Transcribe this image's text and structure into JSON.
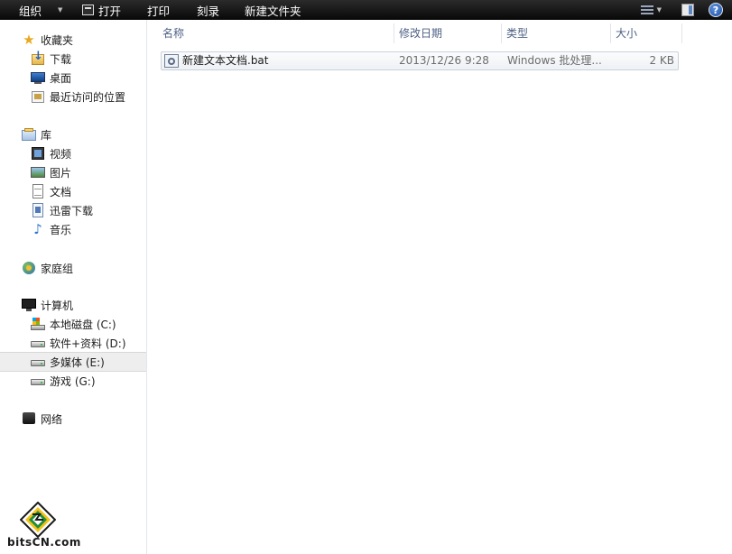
{
  "toolbar": {
    "organize": "组织",
    "open": "打开",
    "print": "打印",
    "burn": "刻录",
    "new_folder": "新建文件夹",
    "icons": [
      "open-icon",
      "views-icon",
      "preview-pane-icon",
      "help-icon"
    ]
  },
  "nav": {
    "favorites": {
      "header": "收藏夹",
      "items": [
        {
          "label": "下载",
          "icon": "download-folder-icon"
        },
        {
          "label": "桌面",
          "icon": "desktop-icon"
        },
        {
          "label": "最近访问的位置",
          "icon": "recent-places-icon"
        }
      ]
    },
    "libraries": {
      "header": "库",
      "items": [
        {
          "label": "视频",
          "icon": "video-icon"
        },
        {
          "label": "图片",
          "icon": "picture-icon"
        },
        {
          "label": "文档",
          "icon": "document-icon"
        },
        {
          "label": "迅雷下载",
          "icon": "thunder-download-icon"
        },
        {
          "label": "音乐",
          "icon": "music-icon"
        }
      ]
    },
    "homegroup": {
      "header": "家庭组"
    },
    "computer": {
      "header": "计算机",
      "items": [
        {
          "label": "本地磁盘 (C:)",
          "icon": "windows-disk-icon"
        },
        {
          "label": "软件+资料 (D:)",
          "icon": "disk-icon"
        },
        {
          "label": "多媒体 (E:)",
          "icon": "disk-icon",
          "selected": true
        },
        {
          "label": "游戏 (G:)",
          "icon": "disk-icon"
        }
      ]
    },
    "network": {
      "header": "网络"
    }
  },
  "columns": {
    "name": "名称",
    "date": "修改日期",
    "type": "类型",
    "size": "大小"
  },
  "files": [
    {
      "name": "新建文本文档.bat",
      "date": "2013/12/26 9:28",
      "type": "Windows 批处理...",
      "size": "2 KB",
      "icon": "batch-file-icon"
    }
  ],
  "watermark": {
    "text": "bitsCN.com"
  },
  "colors": {
    "toolbar_bg": "#0f0f0f",
    "column_header_text": "#4d6185",
    "selection_row": "#eef1f5",
    "nav_selected": "#eeeeee"
  }
}
